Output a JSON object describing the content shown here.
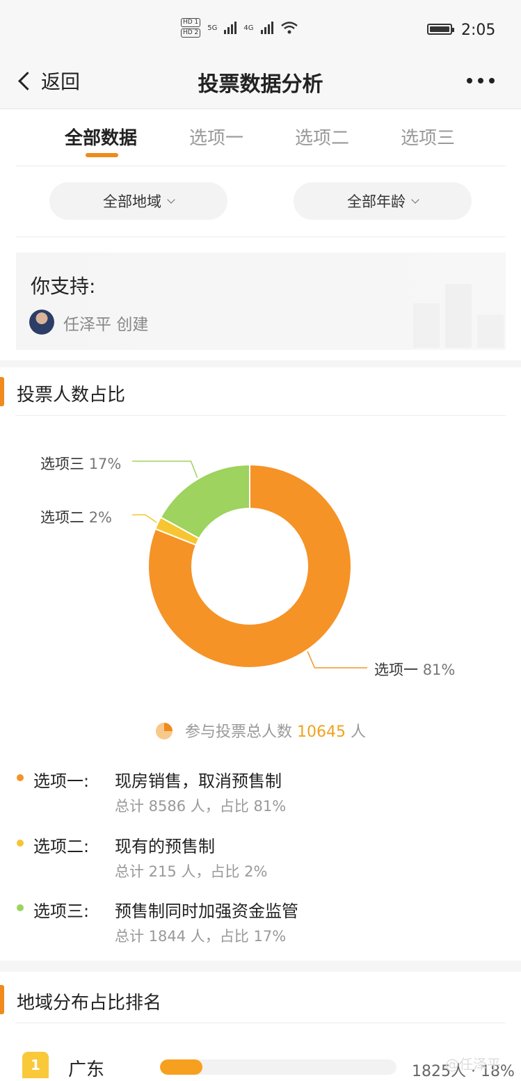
{
  "status_bar": {
    "sim1": "HD 1",
    "sim2": "HD 2",
    "net1": "5G",
    "net2": "4G",
    "time": "2:05"
  },
  "nav": {
    "back_label": "返回",
    "title": "投票数据分析",
    "more_icon": "more-horizontal-icon"
  },
  "tabs": [
    {
      "label": "全部数据",
      "active": true
    },
    {
      "label": "选项一",
      "active": false
    },
    {
      "label": "选项二",
      "active": false
    },
    {
      "label": "选项三",
      "active": false
    }
  ],
  "filters": {
    "region": "全部地域",
    "age": "全部年龄"
  },
  "poll": {
    "question": "你支持:",
    "creator_name": "任泽平",
    "creator_suffix": "创建"
  },
  "vote_share": {
    "section_title": "投票人数占比",
    "total_prefix": "参与投票总人数",
    "total_count": "10645",
    "total_unit": "人"
  },
  "chart_data": {
    "type": "pie",
    "donut": true,
    "categories": [
      "选项一",
      "选项二",
      "选项三"
    ],
    "values": [
      81,
      2,
      17
    ],
    "labels": [
      "81%",
      "2%",
      "17%"
    ],
    "colors": [
      "#f59326",
      "#f7c531",
      "#9dd35e"
    ]
  },
  "options": [
    {
      "label": "选项一:",
      "text": "现房销售，取消预售制",
      "summary": "总计 8586 人，占比 81%",
      "color": "#f59326"
    },
    {
      "label": "选项二:",
      "text": "现有的预售制",
      "summary": "总计 215 人，占比 2%",
      "color": "#f7c531"
    },
    {
      "label": "选项三:",
      "text": "预售制同时加强资金监管",
      "summary": "总计 1844 人，占比 17%",
      "color": "#9dd35e"
    }
  ],
  "region_rank": {
    "section_title": "地域分布占比排名",
    "rows": [
      {
        "rank": "1",
        "name": "广东",
        "value_text": "1825人 · 18%",
        "share": 0.18
      }
    ]
  },
  "watermark": "@任泽平"
}
